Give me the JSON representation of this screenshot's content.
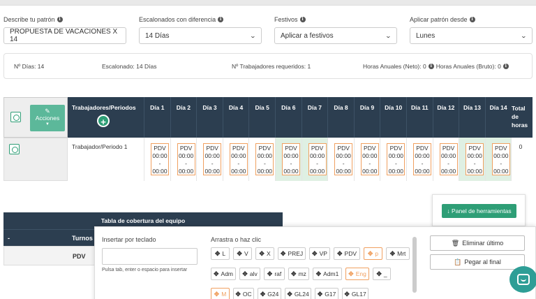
{
  "form": {
    "pattern": {
      "label": "Describe tu patrón",
      "value": "PROPUESTA DE VACACIONES X 14"
    },
    "staggered": {
      "label": "Escalonados con diferencia",
      "value": "14 Días"
    },
    "holidays": {
      "label": "Festivos",
      "value": "Aplicar a festivos"
    },
    "apply_from": {
      "label": "Aplicar patrón desde",
      "value": "Lunes"
    }
  },
  "summary": {
    "days": "Nº Días: 14",
    "staggered": "Escalonado: 14 Días",
    "workers": "Nº Trabajadores requeridos: 1",
    "hours_net": "Horas Anuales (Neto): 0",
    "hours_gross": "Horas Anuales (Bruto): 0"
  },
  "grid": {
    "actions_label": "Acciones",
    "workers_header": "Trabajadores/Periodos",
    "days": [
      "Día 1",
      "Día 2",
      "Día 3",
      "Día 4",
      "Día 5",
      "Día 6",
      "Día 7",
      "Día 8",
      "Día 9",
      "Día 10",
      "Día 11",
      "Día 12",
      "Día 13",
      "Día 14"
    ],
    "green_days": [
      5,
      6,
      12,
      13
    ],
    "total_header": "Total de horas",
    "row": {
      "worker": "Trabajador/Periodo 1",
      "cell": {
        "code": "PDV",
        "start": "00:00",
        "sep": "-",
        "end": "00:00"
      },
      "total": "0"
    }
  },
  "coverage": {
    "title": "Tabla de cobertura del equipo",
    "dash": "-",
    "turnos": "Turnos",
    "row": "PDV"
  },
  "tools": {
    "panel_button": "Panel de herramientas",
    "keyboard_label": "Insertar por teclado",
    "keyboard_hint": "Pulsa tab, enter o espacio para insertar",
    "drag_label": "Arrastra o haz clic",
    "chips": [
      {
        "label": "L"
      },
      {
        "label": "V"
      },
      {
        "label": "X"
      },
      {
        "label": "PREJ"
      },
      {
        "label": "VP"
      },
      {
        "label": "PDV"
      },
      {
        "label": "p",
        "orange": true
      },
      {
        "label": "Mrt"
      },
      {
        "label": "Adm"
      },
      {
        "label": "alv"
      },
      {
        "label": "raf"
      },
      {
        "label": "mz"
      },
      {
        "label": "Adm1"
      },
      {
        "label": "Eng",
        "orange": true
      },
      {
        "label": "_"
      },
      {
        "label": "M",
        "orange": true
      },
      {
        "label": "OC"
      },
      {
        "label": "G24"
      },
      {
        "label": "GL24"
      },
      {
        "label": "G17"
      },
      {
        "label": "GL17"
      }
    ],
    "delete_last": "Eliminar último",
    "paste_end": "Pegar al final"
  },
  "colors": {
    "accent": "#2e9e76",
    "header": "#2c3e50",
    "green_cell": "#dff0e3",
    "orange": "#f0a060"
  }
}
